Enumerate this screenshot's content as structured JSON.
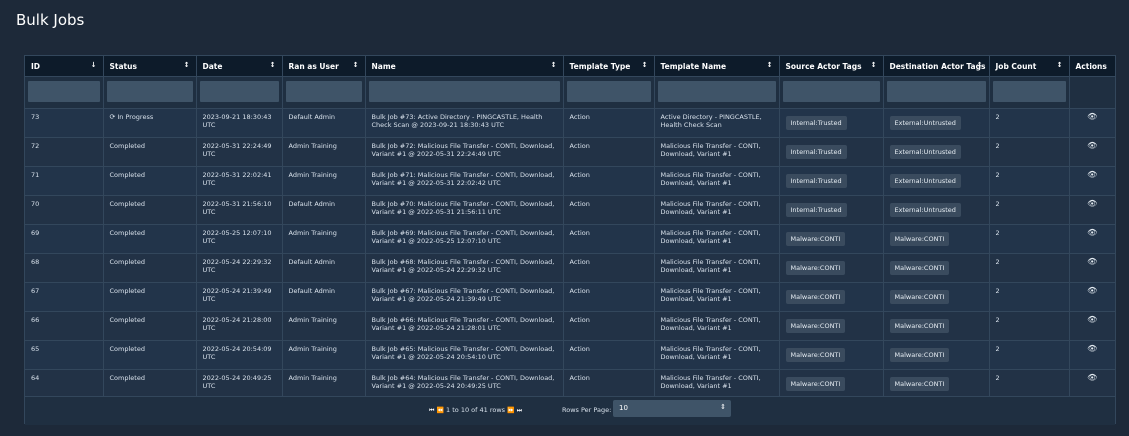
{
  "page": {
    "title": "Bulk Jobs"
  },
  "columns": [
    {
      "label": "ID",
      "sort_icon": "↓"
    },
    {
      "label": "Status",
      "sort_icon": "↕"
    },
    {
      "label": "Date",
      "sort_icon": "↕"
    },
    {
      "label": "Ran as User",
      "sort_icon": "↕"
    },
    {
      "label": "Name",
      "sort_icon": "↕"
    },
    {
      "label": "Template Type",
      "sort_icon": "↕"
    },
    {
      "label": "Template Name",
      "sort_icon": "↕"
    },
    {
      "label": "Source Actor Tags",
      "sort_icon": "↕"
    },
    {
      "label": "Destination Actor Tags",
      "sort_icon": "↕"
    },
    {
      "label": "Job Count",
      "sort_icon": "↕"
    },
    {
      "label": "Actions",
      "sort_icon": ""
    }
  ],
  "rows": [
    {
      "id": "73",
      "status": "In Progress",
      "status_icon": "spinner-icon",
      "date": "2023-09-21 18:30:43 UTC",
      "user": "Default Admin",
      "name": "Bulk Job #73: Active Directory - PINGCASTLE, Health Check Scan @ 2023-09-21 18:30:43 UTC",
      "template_type": "Action",
      "template_name": "Active Directory - PINGCASTLE, Health Check Scan",
      "source_tag": "Internal:Trusted",
      "dest_tag": "External:Untrusted",
      "job_count": "2"
    },
    {
      "id": "72",
      "status": "Completed",
      "status_icon": "",
      "date": "2022-05-31 22:24:49 UTC",
      "user": "Admin Training",
      "name": "Bulk Job #72: Malicious File Transfer - CONTI, Download, Variant #1 @ 2022-05-31 22:24:49 UTC",
      "template_type": "Action",
      "template_name": "Malicious File Transfer - CONTI, Download, Variant #1",
      "source_tag": "Internal:Trusted",
      "dest_tag": "External:Untrusted",
      "job_count": "2"
    },
    {
      "id": "71",
      "status": "Completed",
      "status_icon": "",
      "date": "2022-05-31 22:02:41 UTC",
      "user": "Admin Training",
      "name": "Bulk Job #71: Malicious File Transfer - CONTI, Download, Variant #1 @ 2022-05-31 22:02:42 UTC",
      "template_type": "Action",
      "template_name": "Malicious File Transfer - CONTI, Download, Variant #1",
      "source_tag": "Internal:Trusted",
      "dest_tag": "External:Untrusted",
      "job_count": "2"
    },
    {
      "id": "70",
      "status": "Completed",
      "status_icon": "",
      "date": "2022-05-31 21:56:10 UTC",
      "user": "Default Admin",
      "name": "Bulk Job #70: Malicious File Transfer - CONTI, Download, Variant #1 @ 2022-05-31 21:56:11 UTC",
      "template_type": "Action",
      "template_name": "Malicious File Transfer - CONTI, Download, Variant #1",
      "source_tag": "Internal:Trusted",
      "dest_tag": "External:Untrusted",
      "job_count": "2"
    },
    {
      "id": "69",
      "status": "Completed",
      "status_icon": "",
      "date": "2022-05-25 12:07:10 UTC",
      "user": "Admin Training",
      "name": "Bulk Job #69: Malicious File Transfer - CONTI, Download, Variant #1 @ 2022-05-25 12:07:10 UTC",
      "template_type": "Action",
      "template_name": "Malicious File Transfer - CONTI, Download, Variant #1",
      "source_tag": "Malware:CONTI",
      "dest_tag": "Malware:CONTI",
      "job_count": "2"
    },
    {
      "id": "68",
      "status": "Completed",
      "status_icon": "",
      "date": "2022-05-24 22:29:32 UTC",
      "user": "Default Admin",
      "name": "Bulk Job #68: Malicious File Transfer - CONTI, Download, Variant #1 @ 2022-05-24 22:29:32 UTC",
      "template_type": "Action",
      "template_name": "Malicious File Transfer - CONTI, Download, Variant #1",
      "source_tag": "Malware:CONTI",
      "dest_tag": "Malware:CONTI",
      "job_count": "2"
    },
    {
      "id": "67",
      "status": "Completed",
      "status_icon": "",
      "date": "2022-05-24 21:39:49 UTC",
      "user": "Default Admin",
      "name": "Bulk Job #67: Malicious File Transfer - CONTI, Download, Variant #1 @ 2022-05-24 21:39:49 UTC",
      "template_type": "Action",
      "template_name": "Malicious File Transfer - CONTI, Download, Variant #1",
      "source_tag": "Malware:CONTI",
      "dest_tag": "Malware:CONTI",
      "job_count": "2"
    },
    {
      "id": "66",
      "status": "Completed",
      "status_icon": "",
      "date": "2022-05-24 21:28:00 UTC",
      "user": "Admin Training",
      "name": "Bulk Job #66: Malicious File Transfer - CONTI, Download, Variant #1 @ 2022-05-24 21:28:01 UTC",
      "template_type": "Action",
      "template_name": "Malicious File Transfer - CONTI, Download, Variant #1",
      "source_tag": "Malware:CONTI",
      "dest_tag": "Malware:CONTI",
      "job_count": "2"
    },
    {
      "id": "65",
      "status": "Completed",
      "status_icon": "",
      "date": "2022-05-24 20:54:09 UTC",
      "user": "Admin Training",
      "name": "Bulk Job #65: Malicious File Transfer - CONTI, Download, Variant #1 @ 2022-05-24 20:54:10 UTC",
      "template_type": "Action",
      "template_name": "Malicious File Transfer - CONTI, Download, Variant #1",
      "source_tag": "Malware:CONTI",
      "dest_tag": "Malware:CONTI",
      "job_count": "2"
    },
    {
      "id": "64",
      "status": "Completed",
      "status_icon": "",
      "date": "2022-05-24 20:49:25 UTC",
      "user": "Admin Training",
      "name": "Bulk Job #64: Malicious File Transfer - CONTI, Download, Variant #1 @ 2022-05-24 20:49:25 UTC",
      "template_type": "Action",
      "template_name": "Malicious File Transfer - CONTI, Download, Variant #1",
      "source_tag": "Malware:CONTI",
      "dest_tag": "Malware:CONTI",
      "job_count": "2"
    }
  ],
  "actions": {
    "view_icon_glyph": "👁",
    "icon_name": "eye-icon"
  },
  "status_icon_glyph": "⟳",
  "pagination": {
    "first_glyph": "⏮",
    "prev_glyph": "⏪",
    "info": "1 to 10 of 41 rows",
    "next_glyph": "⏩",
    "last_glyph": "⏭",
    "rows_per_page_label": "Rows Per Page:",
    "rows_per_page_value": "10",
    "select_arrow_glyph": "⇕"
  }
}
